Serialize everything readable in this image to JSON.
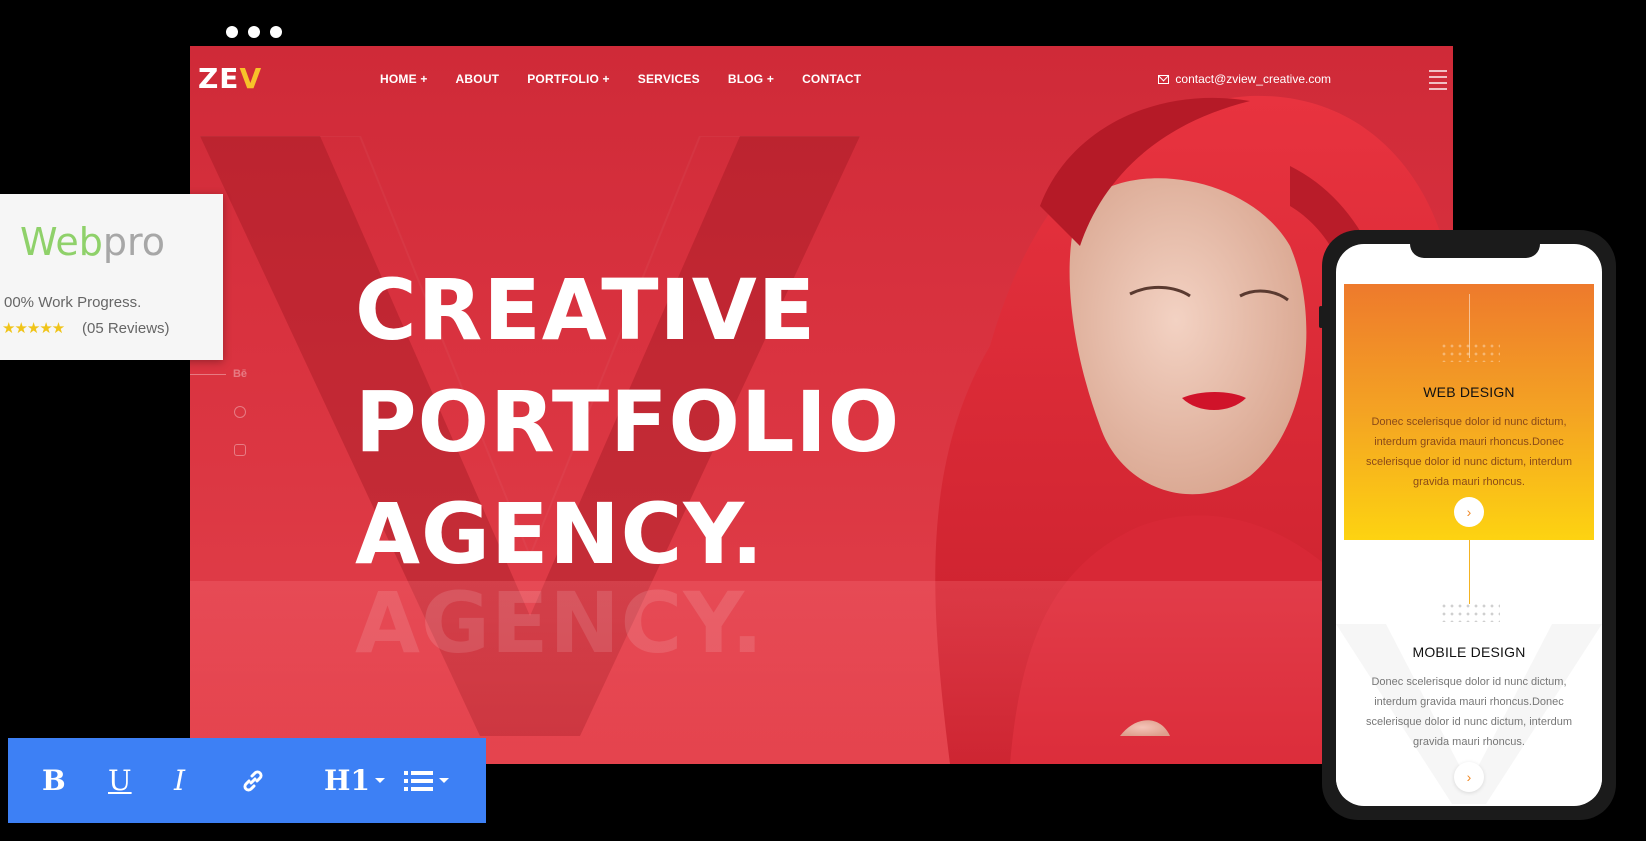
{
  "site": {
    "logo_main": "ZE",
    "logo_accent": "V",
    "nav": [
      "HOME +",
      "ABOUT",
      "PORTFOLIO +",
      "SERVICES",
      "BLOG +",
      "CONTACT"
    ],
    "email": "contact@zview_creative.com",
    "headline": [
      "CREATIVE",
      "PORTFOLIO",
      "AGENCY."
    ],
    "headline_reflection": "AGENCY.",
    "social": [
      "Bē",
      "dribbble",
      "instagram"
    ]
  },
  "review": {
    "brand_web": "Web",
    "brand_pro": "pro",
    "progress": "00% Work Progress.",
    "stars": "★★★★★",
    "rating": 5,
    "count": "(05 Reviews)"
  },
  "toolbar": {
    "bold": "B",
    "underline": "U",
    "italic": "I",
    "heading": "H1",
    "items": [
      "bold",
      "underline",
      "italic",
      "link",
      "heading",
      "list"
    ]
  },
  "phone": {
    "cards": [
      {
        "title": "WEB DESIGN",
        "text": "Donec scelerisque dolor id nunc dictum, interdum gravida mauri rhoncus.Donec scelerisque dolor id nunc dictum, interdum gravida mauri rhoncus.",
        "button": "›"
      },
      {
        "title": "MOBILE DESIGN",
        "text": "Donec scelerisque dolor id nunc dictum, interdum gravida mauri rhoncus.Donec scelerisque dolor id nunc dictum, interdum gravida mauri rhoncus.",
        "button": "›"
      }
    ]
  },
  "colors": {
    "hero_red": "#d9323f",
    "accent_yellow": "#f7c22a",
    "toolbar_blue": "#3d80f5",
    "card_orange": "#ee7a2c",
    "card_yellow": "#fdd311",
    "brand_green": "#8fd16a"
  }
}
